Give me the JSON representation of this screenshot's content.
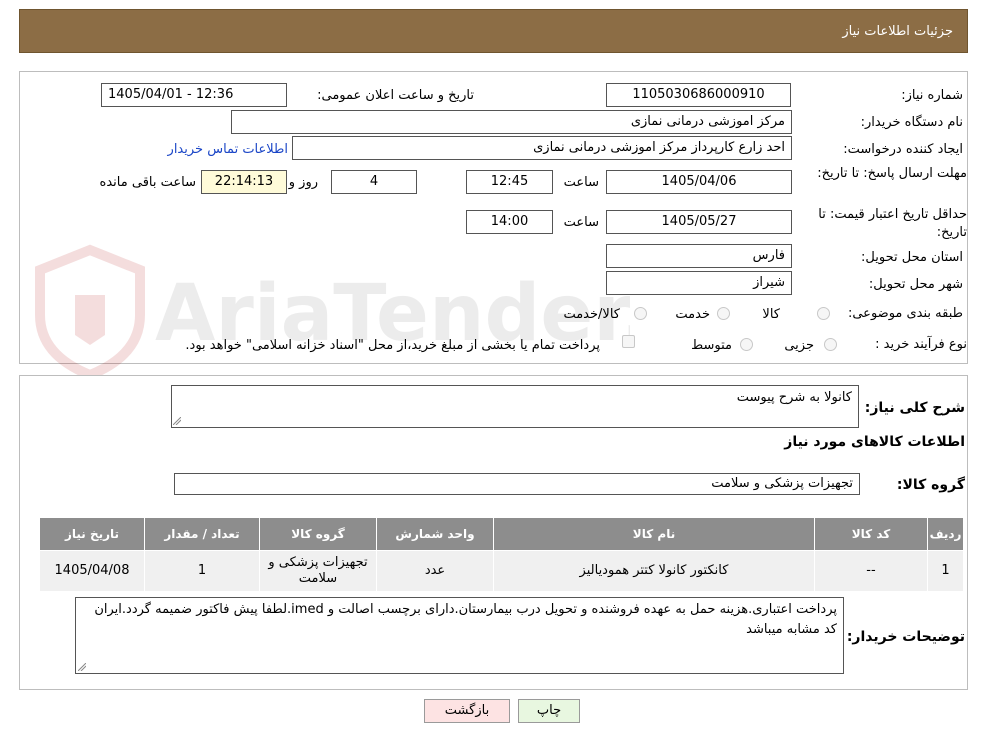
{
  "header": {
    "title": "جزئیات اطلاعات نیاز"
  },
  "form": {
    "need_number_label": "شماره نیاز:",
    "need_number": "1105030686000910",
    "announce_label": "تاریخ و ساعت اعلان عمومی:",
    "announce_value": "1405/04/01 - 12:36",
    "buyer_org_label": "نام دستگاه خریدار:",
    "buyer_org": "مرکز اموزشی درمانی نمازی",
    "creator_label": "ایجاد کننده درخواست:",
    "creator": "احد زارع کارپرداز مرکز اموزشی درمانی نمازی",
    "buyer_contact_link": "اطلاعات تماس خریدار",
    "deadline_label": "مهلت ارسال پاسخ: تا تاریخ:",
    "deadline_date": "1405/04/06",
    "time_label": "ساعت",
    "deadline_time": "12:45",
    "days": "4",
    "days_label": "روز و",
    "remaining_time": "22:14:13",
    "remaining_label": "ساعت باقی مانده",
    "validity_label": "حداقل تاریخ اعتبار قیمت: تا تاریخ:",
    "validity_date": "1405/05/27",
    "validity_time": "14:00",
    "province_label": "استان محل تحویل:",
    "province": "فارس",
    "city_label": "شهر محل تحویل:",
    "city": "شیراز",
    "category_label": "طبقه بندی موضوعی:",
    "category_options": [
      "کالا",
      "خدمت",
      "کالا/خدمت"
    ],
    "process_label": "نوع فرآیند خرید :",
    "process_options": [
      "جزیی",
      "متوسط"
    ],
    "payment_note": "پرداخت تمام یا بخشی از مبلغ خرید،از محل \"اسناد خزانه اسلامی\" خواهد بود."
  },
  "details": {
    "summary_label": "شرح کلی نیاز:",
    "summary": "کانولا به شرح پیوست",
    "goods_info_title": "اطلاعات کالاهای مورد نیاز",
    "group_label": "گروه کالا:",
    "group_value": "تجهیزات پزشکی و سلامت",
    "table": {
      "headers": [
        "ردیف",
        "کد کالا",
        "نام کالا",
        "واحد شمارش",
        "گروه کالا",
        "تعداد / مقدار",
        "تاریخ نیاز"
      ],
      "rows": [
        [
          "1",
          "--",
          "کانکتور کانولا کتتر همودیالیز",
          "عدد",
          "تجهیزات پزشکی و سلامت",
          "1",
          "1405/04/08"
        ]
      ]
    },
    "buyer_notes_label": "توضیحات خریدار:",
    "buyer_notes": "پرداخت اعتباری.هزینه حمل به عهده فروشنده و تحویل درب بیمارستان.دارای برچسب اصالت و imed.لطفا پیش فاکتور ضمیمه گردد.ایران کد مشابه میباشد"
  },
  "buttons": {
    "print": "چاپ",
    "back": "بازگشت"
  },
  "watermark": {
    "text": "AriaTender.neT"
  },
  "colors": {
    "header": "#8c6d45",
    "back_button": "#fde3e3",
    "print_button": "#e8f7e0",
    "link": "#1b46c7",
    "table_header": "#8d8d8d"
  }
}
